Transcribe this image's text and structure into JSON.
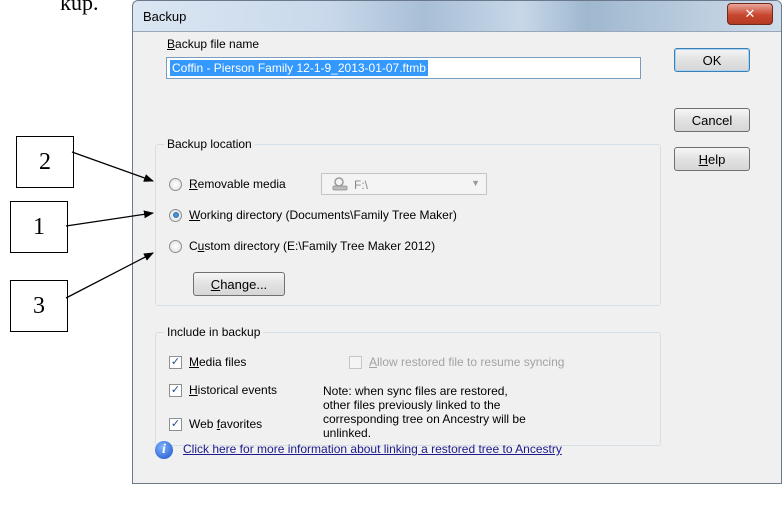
{
  "top_text": "kup.",
  "callouts": [
    "2",
    "1",
    "3"
  ],
  "window": {
    "title": "Backup",
    "close_glyph": "✕"
  },
  "file_name": {
    "label_hotkey": "B",
    "label_rest": "ackup file name",
    "value": "Coffin - Pierson Family 12-1-9_2013-01-07.ftmb"
  },
  "buttons": {
    "ok": "OK",
    "cancel": "Cancel",
    "help_hotkey": "H",
    "help_rest": "elp",
    "change_hotkey": "C",
    "change_rest": "hange..."
  },
  "location": {
    "label": "Backup location",
    "removable": {
      "hotkey": "R",
      "rest": "emovable media",
      "selected": false
    },
    "removable_drive": "F:\\",
    "working": {
      "hotkey": "W",
      "rest": "orking directory (Documents\\Family Tree Maker)",
      "selected": true
    },
    "custom": {
      "pre": "C",
      "hotkey": "u",
      "rest": "stom directory (E:\\Family Tree Maker 2012)",
      "selected": false
    }
  },
  "include": {
    "label": "Include in backup",
    "media": {
      "hotkey": "M",
      "rest": "edia files",
      "checked": true
    },
    "historical": {
      "hotkey": "H",
      "rest": "istorical events",
      "checked": true
    },
    "web": {
      "pre": "Web ",
      "hotkey": "f",
      "rest": "avorites",
      "checked": true
    },
    "allow": {
      "hotkey": "A",
      "rest": "llow restored file to resume syncing",
      "checked": false,
      "enabled": false
    },
    "note": "Note: when sync files are restored, other files previously linked to the corresponding tree on Ancestry will be unlinked."
  },
  "info": {
    "icon_glyph": "i",
    "link": "Click here for more information about linking a restored tree to Ancestry"
  },
  "colors": {
    "accent": "#3399ff",
    "link": "#1a1a8c",
    "close": "#c8462f"
  }
}
